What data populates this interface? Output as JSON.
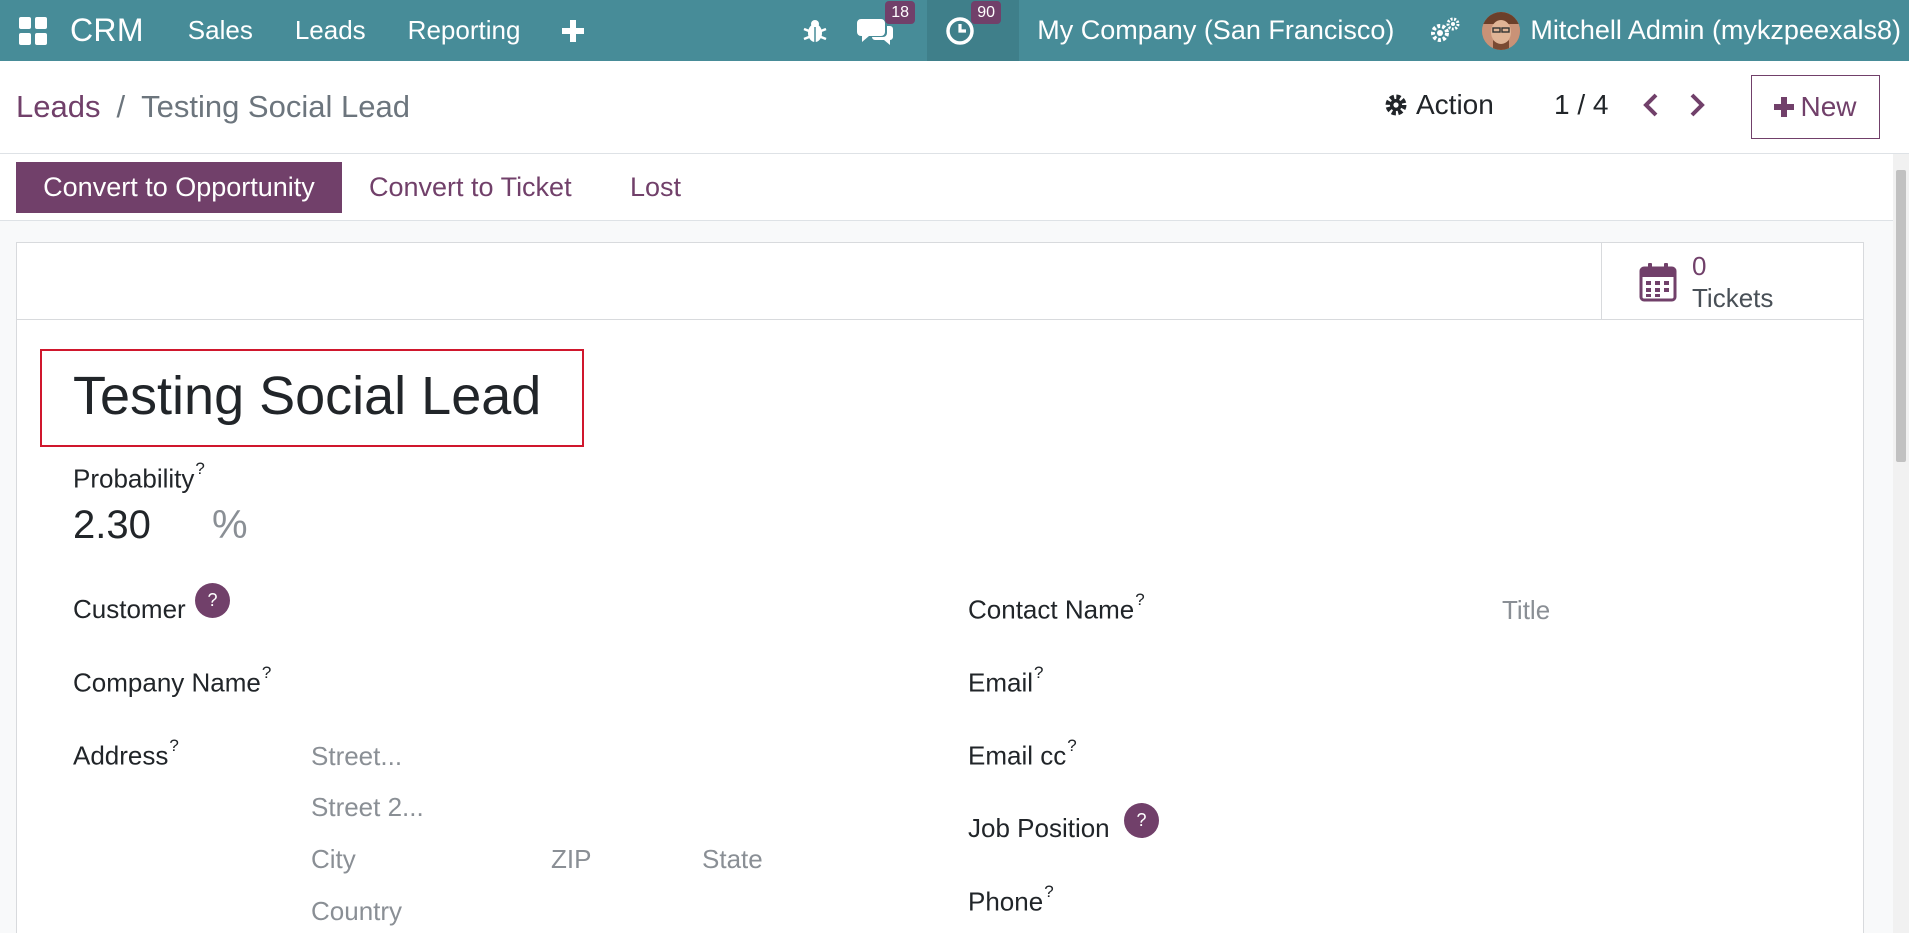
{
  "navbar": {
    "brand": "CRM",
    "menus": [
      "Sales",
      "Leads",
      "Reporting"
    ],
    "messages_count": "18",
    "activities_count": "90",
    "company": "My Company (San Francisco)",
    "user": "Mitchell Admin (mykzpeexals8)"
  },
  "control": {
    "breadcrumb_root": "Leads",
    "breadcrumb_sep": "/",
    "breadcrumb_current": "Testing Social Lead",
    "action_label": "Action",
    "pager": "1 / 4",
    "new_label": "New"
  },
  "statusbar": {
    "convert_opportunity": "Convert to Opportunity",
    "convert_ticket": "Convert to Ticket",
    "lost": "Lost"
  },
  "stat_buttons": {
    "tickets_value": "0",
    "tickets_label": "Tickets"
  },
  "form": {
    "title": "Testing Social Lead",
    "probability_label": "Probability",
    "probability_value": "2.30",
    "probability_unit": "%",
    "help_mark": "?",
    "customer_label": "Customer",
    "company_name_label": "Company Name",
    "address_label": "Address",
    "street_ph": "Street...",
    "street2_ph": "Street 2...",
    "city_ph": "City",
    "zip_ph": "ZIP",
    "state_ph": "State",
    "country_ph": "Country",
    "contact_name_label": "Contact Name",
    "title_ph": "Title",
    "email_label": "Email",
    "email_cc_label": "Email cc",
    "job_position_label": "Job Position",
    "phone_label": "Phone"
  },
  "colors": {
    "navbar": "#478c98",
    "primary": "#71406a",
    "highlight": "#d0172d"
  }
}
